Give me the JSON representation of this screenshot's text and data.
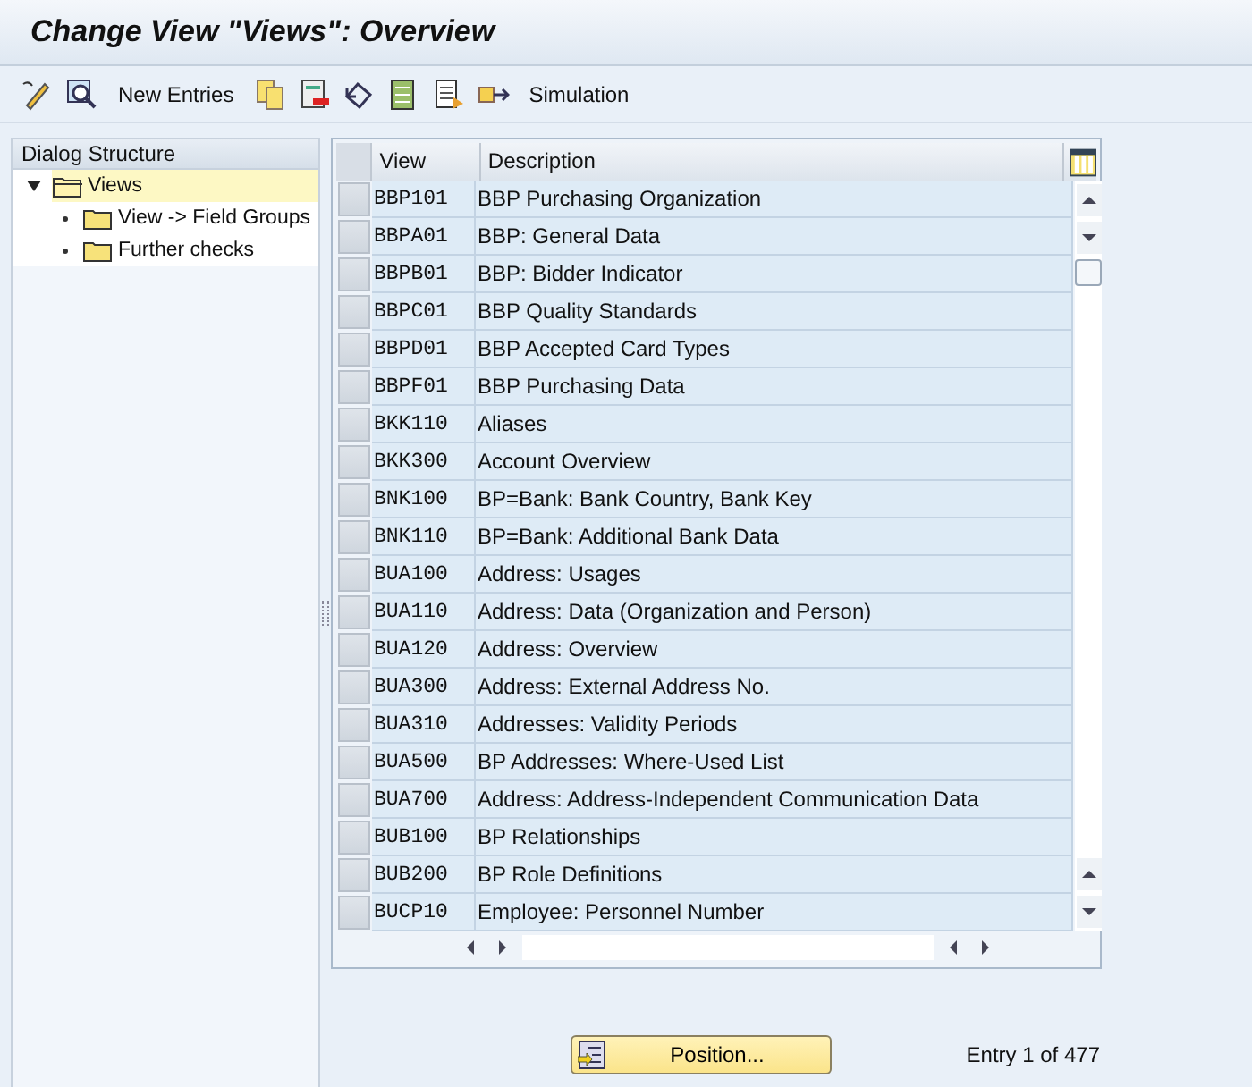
{
  "window": {
    "title": "Change View \"Views\": Overview"
  },
  "toolbar": {
    "items": [
      {
        "kind": "icon"
      },
      {
        "kind": "icon"
      },
      {
        "kind": "text",
        "label": "New Entries"
      },
      {
        "kind": "icon"
      },
      {
        "kind": "icon"
      },
      {
        "kind": "icon"
      },
      {
        "kind": "icon"
      },
      {
        "kind": "icon"
      },
      {
        "kind": "icon"
      },
      {
        "kind": "text",
        "label": "Simulation"
      }
    ]
  },
  "dialog_structure": {
    "title": "Dialog Structure",
    "items": [
      {
        "label": "Views",
        "expanded": true,
        "selected": true,
        "children": [
          {
            "label": "View -> Field Groups",
            "selected": false
          },
          {
            "label": "Further checks",
            "selected": false
          }
        ]
      }
    ]
  },
  "table": {
    "columns": [
      "View",
      "Description"
    ],
    "rows": [
      [
        "BBP101",
        "BBP Purchasing Organization"
      ],
      [
        "BBPA01",
        "BBP: General Data"
      ],
      [
        "BBPB01",
        "BBP: Bidder Indicator"
      ],
      [
        "BBPC01",
        "BBP Quality Standards"
      ],
      [
        "BBPD01",
        "BBP Accepted Card Types"
      ],
      [
        "BBPF01",
        "BBP Purchasing Data"
      ],
      [
        "BKK110",
        "Aliases"
      ],
      [
        "BKK300",
        "Account Overview"
      ],
      [
        "BNK100",
        "BP=Bank: Bank Country, Bank Key"
      ],
      [
        "BNK110",
        "BP=Bank: Additional Bank Data"
      ],
      [
        "BUA100",
        "Address: Usages"
      ],
      [
        "BUA110",
        "Address: Data (Organization and Person)"
      ],
      [
        "BUA120",
        "Address: Overview"
      ],
      [
        "BUA300",
        "Address: External Address No."
      ],
      [
        "BUA310",
        "Addresses: Validity Periods"
      ],
      [
        "BUA500",
        "BP Addresses: Where-Used List"
      ],
      [
        "BUA700",
        "Address: Address-Independent Communication Data"
      ],
      [
        "BUB100",
        "BP Relationships"
      ],
      [
        "BUB200",
        "BP Role Definitions"
      ],
      [
        "BUCP10",
        "Employee: Personnel Number"
      ]
    ]
  },
  "position_button": {
    "label": "Position..."
  },
  "entry_info": "Entry 1 of 477"
}
